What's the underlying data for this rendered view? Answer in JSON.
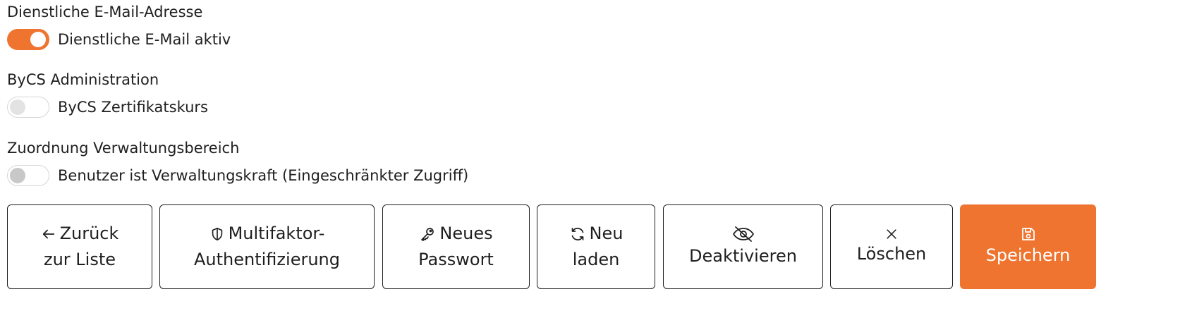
{
  "sections": [
    {
      "title": "Dienstliche E-Mail-Adresse",
      "toggle_label": "Dienstliche E-Mail aktiv",
      "toggle_on": true
    },
    {
      "title": "ByCS Administration",
      "toggle_label": "ByCS Zertifikatskurs",
      "toggle_on": false
    },
    {
      "title": "Zuordnung Verwaltungsbereich",
      "toggle_label": "Benutzer ist Verwaltungskraft (Eingeschränkter Zugriff)",
      "toggle_on": false
    }
  ],
  "buttons": {
    "back": {
      "line1": "Zurück",
      "line2": "zur Liste",
      "icon": "arrow-left-icon"
    },
    "mfa": {
      "line1": "Multifaktor-",
      "line2": "Authentifizierung",
      "icon": "shield-icon"
    },
    "password": {
      "line1": "Neues",
      "line2": "Passwort",
      "icon": "key-icon"
    },
    "reload": {
      "line1": "Neu",
      "line2": "laden",
      "icon": "refresh-icon"
    },
    "deactivate": {
      "label": "Deaktivieren",
      "icon": "eye-off-icon"
    },
    "delete": {
      "label": "Löschen",
      "icon": "close-icon"
    },
    "save": {
      "label": "Speichern",
      "icon": "save-icon"
    }
  },
  "colors": {
    "accent": "#ee7430",
    "text": "#1f1f1f",
    "border": "#1f1f1f"
  }
}
